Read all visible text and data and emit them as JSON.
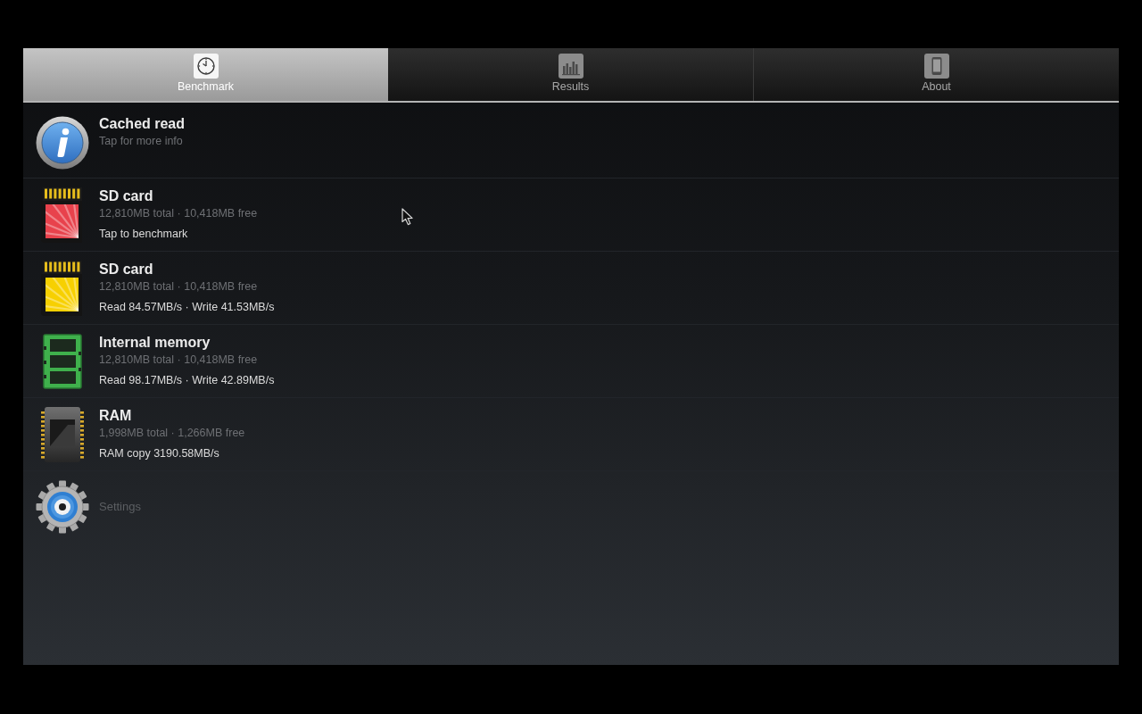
{
  "tabs": [
    {
      "label": "Benchmark",
      "selected": true
    },
    {
      "label": "Results",
      "selected": false
    },
    {
      "label": "About",
      "selected": false
    }
  ],
  "items": [
    {
      "kind": "info",
      "title": "Cached read",
      "subtitle": "Tap for more info"
    },
    {
      "kind": "sd_card",
      "color": "#e8424c",
      "title": "SD card",
      "subtitle": "12,810MB total · 10,418MB free",
      "status": "Tap to benchmark"
    },
    {
      "kind": "sd_card",
      "color": "#f7d000",
      "title": "SD card",
      "subtitle": "12,810MB total · 10,418MB free",
      "status": "Read 84.57MB/s · Write 41.53MB/s"
    },
    {
      "kind": "internal",
      "title": "Internal memory",
      "subtitle": "12,810MB total · 10,418MB free",
      "status": "Read 98.17MB/s · Write 42.89MB/s"
    },
    {
      "kind": "ram",
      "title": "RAM",
      "subtitle": "1,998MB total · 1,266MB free",
      "status": "RAM copy 3190.58MB/s"
    },
    {
      "kind": "settings",
      "title": "Settings"
    }
  ]
}
